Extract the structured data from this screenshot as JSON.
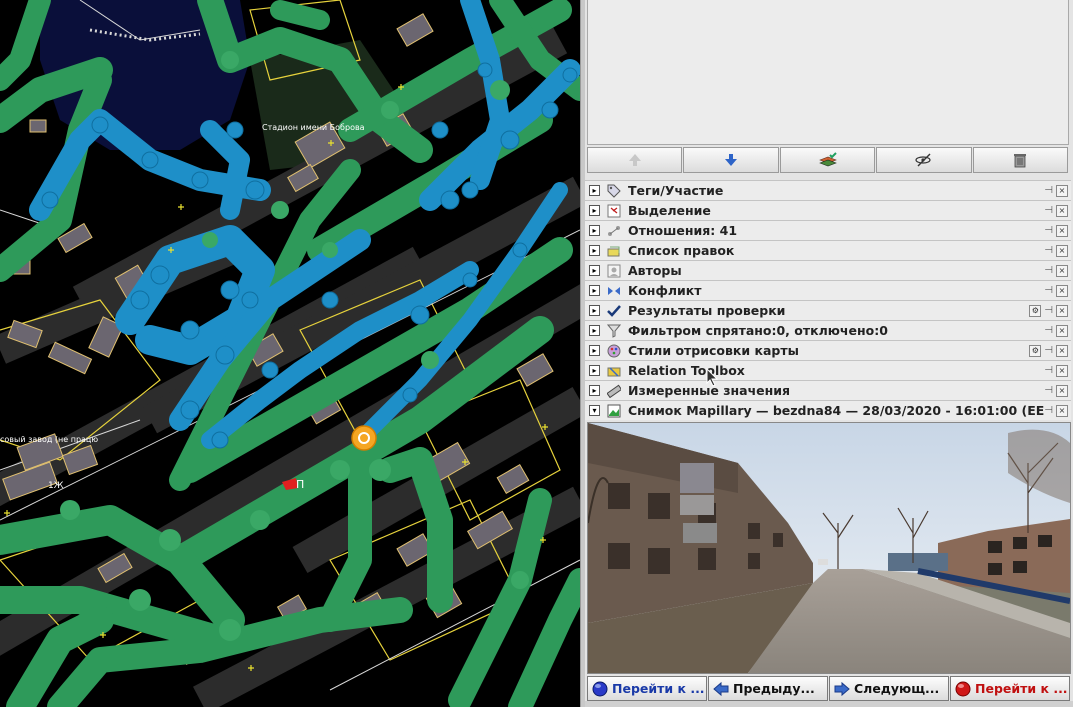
{
  "map": {
    "label_stadium": "Стадион имени Боброва",
    "label_factory": "совый завод (не працю",
    "label_building": "1Ж",
    "label_mark": "П"
  },
  "toolbar": {
    "buttons": [
      "up-arrow",
      "down-arrow",
      "apply-layers",
      "hide-layers",
      "delete"
    ]
  },
  "panels": [
    {
      "title": "Теги/Участие",
      "icon": "tag-icon",
      "expanded": false,
      "extra": false
    },
    {
      "title": "Выделение",
      "icon": "selection-icon",
      "expanded": false,
      "extra": false
    },
    {
      "title": "Отношения: 41",
      "icon": "relation-icon",
      "expanded": false,
      "extra": false
    },
    {
      "title": "Список правок",
      "icon": "changeset-icon",
      "expanded": false,
      "extra": false
    },
    {
      "title": "Авторы",
      "icon": "authors-icon",
      "expanded": false,
      "extra": false
    },
    {
      "title": "Конфликт",
      "icon": "conflict-icon",
      "expanded": false,
      "extra": false
    },
    {
      "title": "Результаты проверки",
      "icon": "validation-icon",
      "expanded": false,
      "extra": true
    },
    {
      "title": "Фильтром спрятано:0, отключено:0",
      "icon": "filter-icon",
      "expanded": false,
      "extra": false
    },
    {
      "title": "Стили отрисовки карты",
      "icon": "map-style-icon",
      "expanded": false,
      "extra": true
    },
    {
      "title": "Relation Toolbox",
      "icon": "relation-toolbox-icon",
      "expanded": false,
      "extra": false
    },
    {
      "title": "Измеренные значения",
      "icon": "ruler-icon",
      "expanded": false,
      "extra": false
    },
    {
      "title": "Снимок Mapillary — bezdna84 — 28/03/2020 - 16:01:00 (EE",
      "icon": "mapillary-image-icon",
      "expanded": true,
      "extra": false
    }
  ],
  "navigation": {
    "goto_blue": "Перейти к ...",
    "previous": "Предыду...",
    "next": "Следующ...",
    "goto_red": "Перейти к ..."
  },
  "colors": {
    "track_green": "#2e9a5a",
    "sequence_blue": "#1e8fc8",
    "map_background": "#000000",
    "road_grey": "#2a2a2a",
    "building_fill": "#6b6670",
    "building_outline": "#e0c070",
    "selected_marker": "#f5a623"
  }
}
